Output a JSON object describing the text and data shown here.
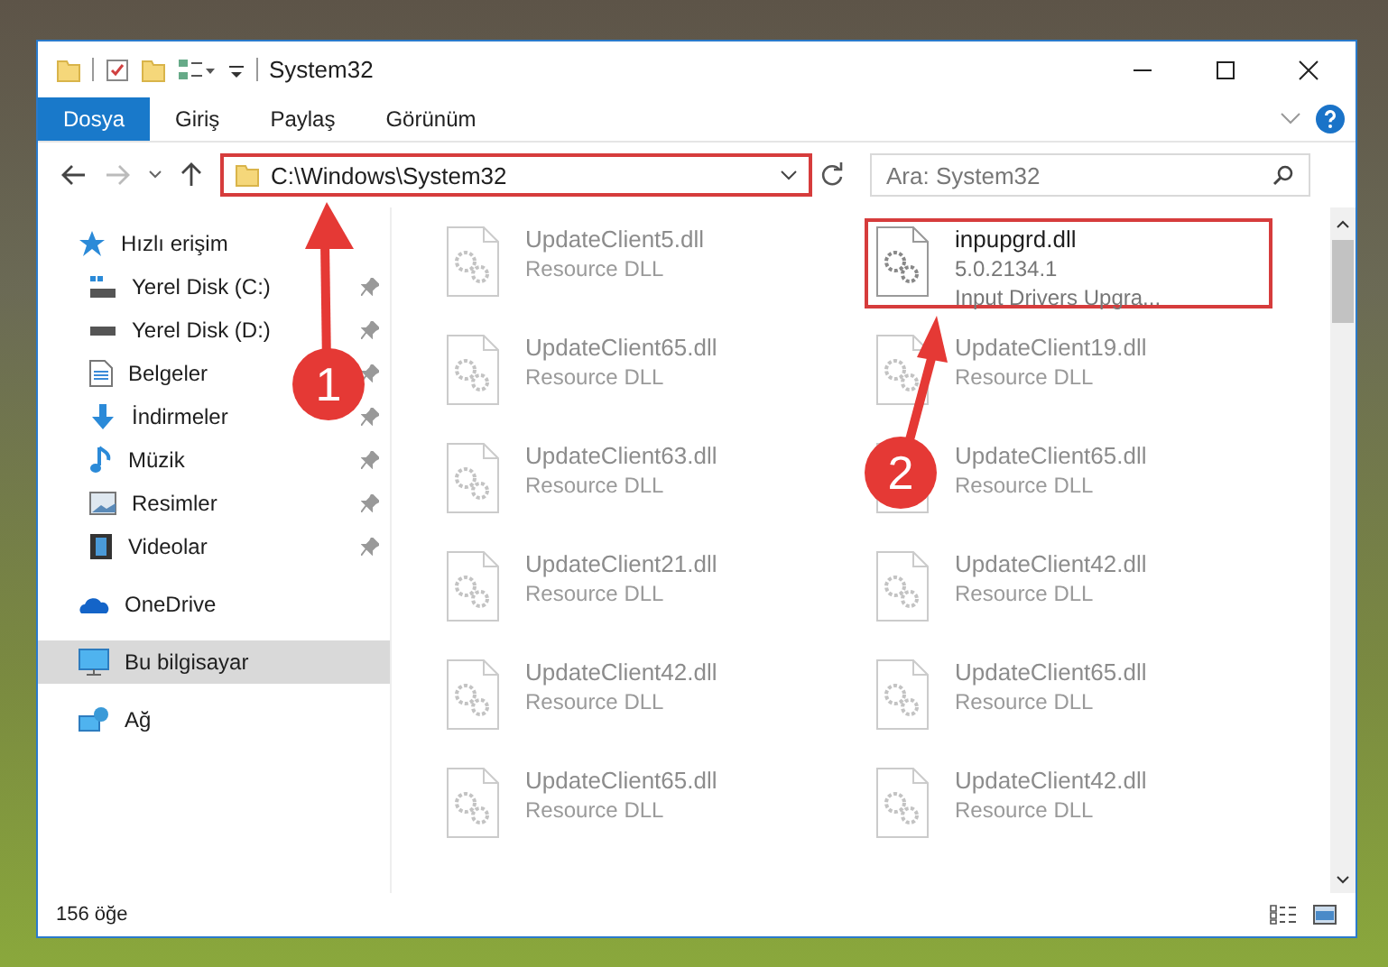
{
  "window": {
    "title": "System32"
  },
  "ribbon_tabs": [
    {
      "label": "Dosya",
      "selected": true
    },
    {
      "label": "Giriş",
      "selected": false
    },
    {
      "label": "Paylaş",
      "selected": false
    },
    {
      "label": "Görünüm",
      "selected": false
    }
  ],
  "address": {
    "path": "C:\\Windows\\System32"
  },
  "search": {
    "placeholder": "Ara: System32"
  },
  "sidebar": {
    "items": [
      {
        "label": "Hızlı erişim",
        "kind": "star",
        "selected": false,
        "children": [
          {
            "label": "Yerel Disk (C:)",
            "kind": "drive-c",
            "pinned": true
          },
          {
            "label": "Yerel Disk (D:)",
            "kind": "drive",
            "pinned": true
          },
          {
            "label": "Belgeler",
            "kind": "docs",
            "pinned": true
          },
          {
            "label": "İndirmeler",
            "kind": "download",
            "pinned": true
          },
          {
            "label": "Müzik",
            "kind": "music",
            "pinned": true
          },
          {
            "label": "Resimler",
            "kind": "pictures",
            "pinned": true
          },
          {
            "label": "Videolar",
            "kind": "videos",
            "pinned": true
          }
        ]
      },
      {
        "label": "OneDrive",
        "kind": "cloud",
        "selected": false
      },
      {
        "label": "Bu bilgisayar",
        "kind": "pc",
        "selected": true
      },
      {
        "label": "Ağ",
        "kind": "network",
        "selected": false
      }
    ]
  },
  "files": [
    {
      "name": "UpdateClient5.dll",
      "description": "Resource DLL",
      "highlighted": false
    },
    {
      "name": "inpupgrd.dll",
      "version": "5.0.2134.1",
      "description": "Input Drivers Upgra...",
      "highlighted": true
    },
    {
      "name": "UpdateClient65.dll",
      "description": "Resource DLL",
      "highlighted": false
    },
    {
      "name": "UpdateClient19.dll",
      "description": "Resource DLL",
      "highlighted": false
    },
    {
      "name": "UpdateClient63.dll",
      "description": "Resource DLL",
      "highlighted": false
    },
    {
      "name": "UpdateClient65.dll",
      "description": "Resource DLL",
      "highlighted": false
    },
    {
      "name": "UpdateClient21.dll",
      "description": "Resource DLL",
      "highlighted": false
    },
    {
      "name": "UpdateClient42.dll",
      "description": "Resource DLL",
      "highlighted": false
    },
    {
      "name": "UpdateClient42.dll",
      "description": "Resource DLL",
      "highlighted": false
    },
    {
      "name": "UpdateClient65.dll",
      "description": "Resource DLL",
      "highlighted": false
    },
    {
      "name": "UpdateClient65.dll",
      "description": "Resource DLL",
      "highlighted": false
    },
    {
      "name": "UpdateClient42.dll",
      "description": "Resource DLL",
      "highlighted": false
    }
  ],
  "status_bar": {
    "item_count": "156 öğe"
  },
  "callouts": [
    {
      "number": "1"
    },
    {
      "number": "2"
    }
  ]
}
